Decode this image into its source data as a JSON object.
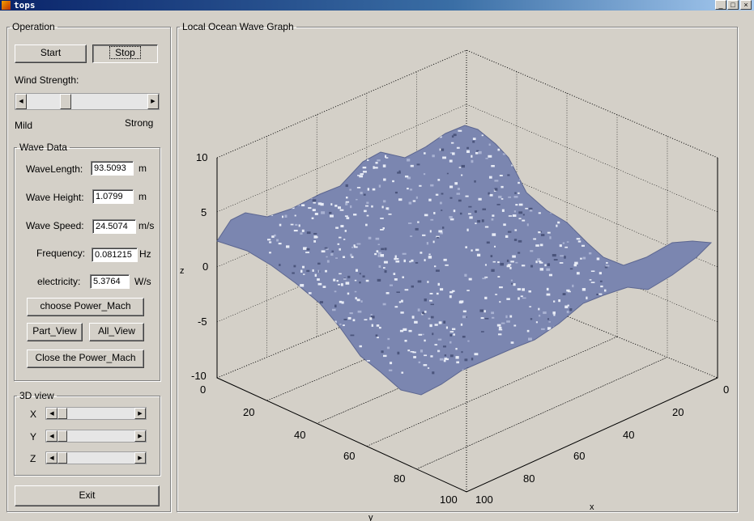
{
  "window": {
    "title": "tops",
    "controls": [
      "_",
      "□",
      "×"
    ]
  },
  "operation": {
    "legend": "Operation",
    "start_label": "Start",
    "stop_label": "Stop",
    "wind_label": "Wind Strength:",
    "wind_value": 0.3,
    "mild_label": "Mild",
    "strong_label": "Strong"
  },
  "wave_data": {
    "legend": "Wave Data",
    "rows": [
      {
        "label": "WaveLength:",
        "value": "93.5093",
        "unit": "m"
      },
      {
        "label": "Wave Height:",
        "value": "1.0799",
        "unit": "m"
      },
      {
        "label": "Wave Speed:",
        "value": "24.5074",
        "unit": "m/s"
      },
      {
        "label": "Frequency:",
        "value": "0.081215",
        "unit": "Hz"
      },
      {
        "label": "electricity:",
        "value": "5.3764",
        "unit": "W/s"
      }
    ],
    "choose_label": "choose Power_Mach",
    "part_view_label": "Part_View",
    "all_view_label": "All_View",
    "close_label": "Close the Power_Mach"
  },
  "view3d": {
    "legend": "3D view",
    "sliders": [
      {
        "label": "X",
        "value": 0.0
      },
      {
        "label": "Y",
        "value": 0.0
      },
      {
        "label": "Z",
        "value": 0.0
      }
    ]
  },
  "exit_label": "Exit",
  "graph": {
    "legend": "Local Ocean Wave Graph",
    "z_ticks": [
      "10",
      "5",
      "0",
      "-5",
      "-10"
    ],
    "y_ticks": [
      "0",
      "20",
      "40",
      "60",
      "80",
      "100"
    ],
    "x_ticks": [
      "0",
      "20",
      "40",
      "60",
      "80",
      "100"
    ],
    "zlabel": "z",
    "xlabel": "x",
    "ylabel": "y",
    "surface_color": "#7b86b0"
  }
}
